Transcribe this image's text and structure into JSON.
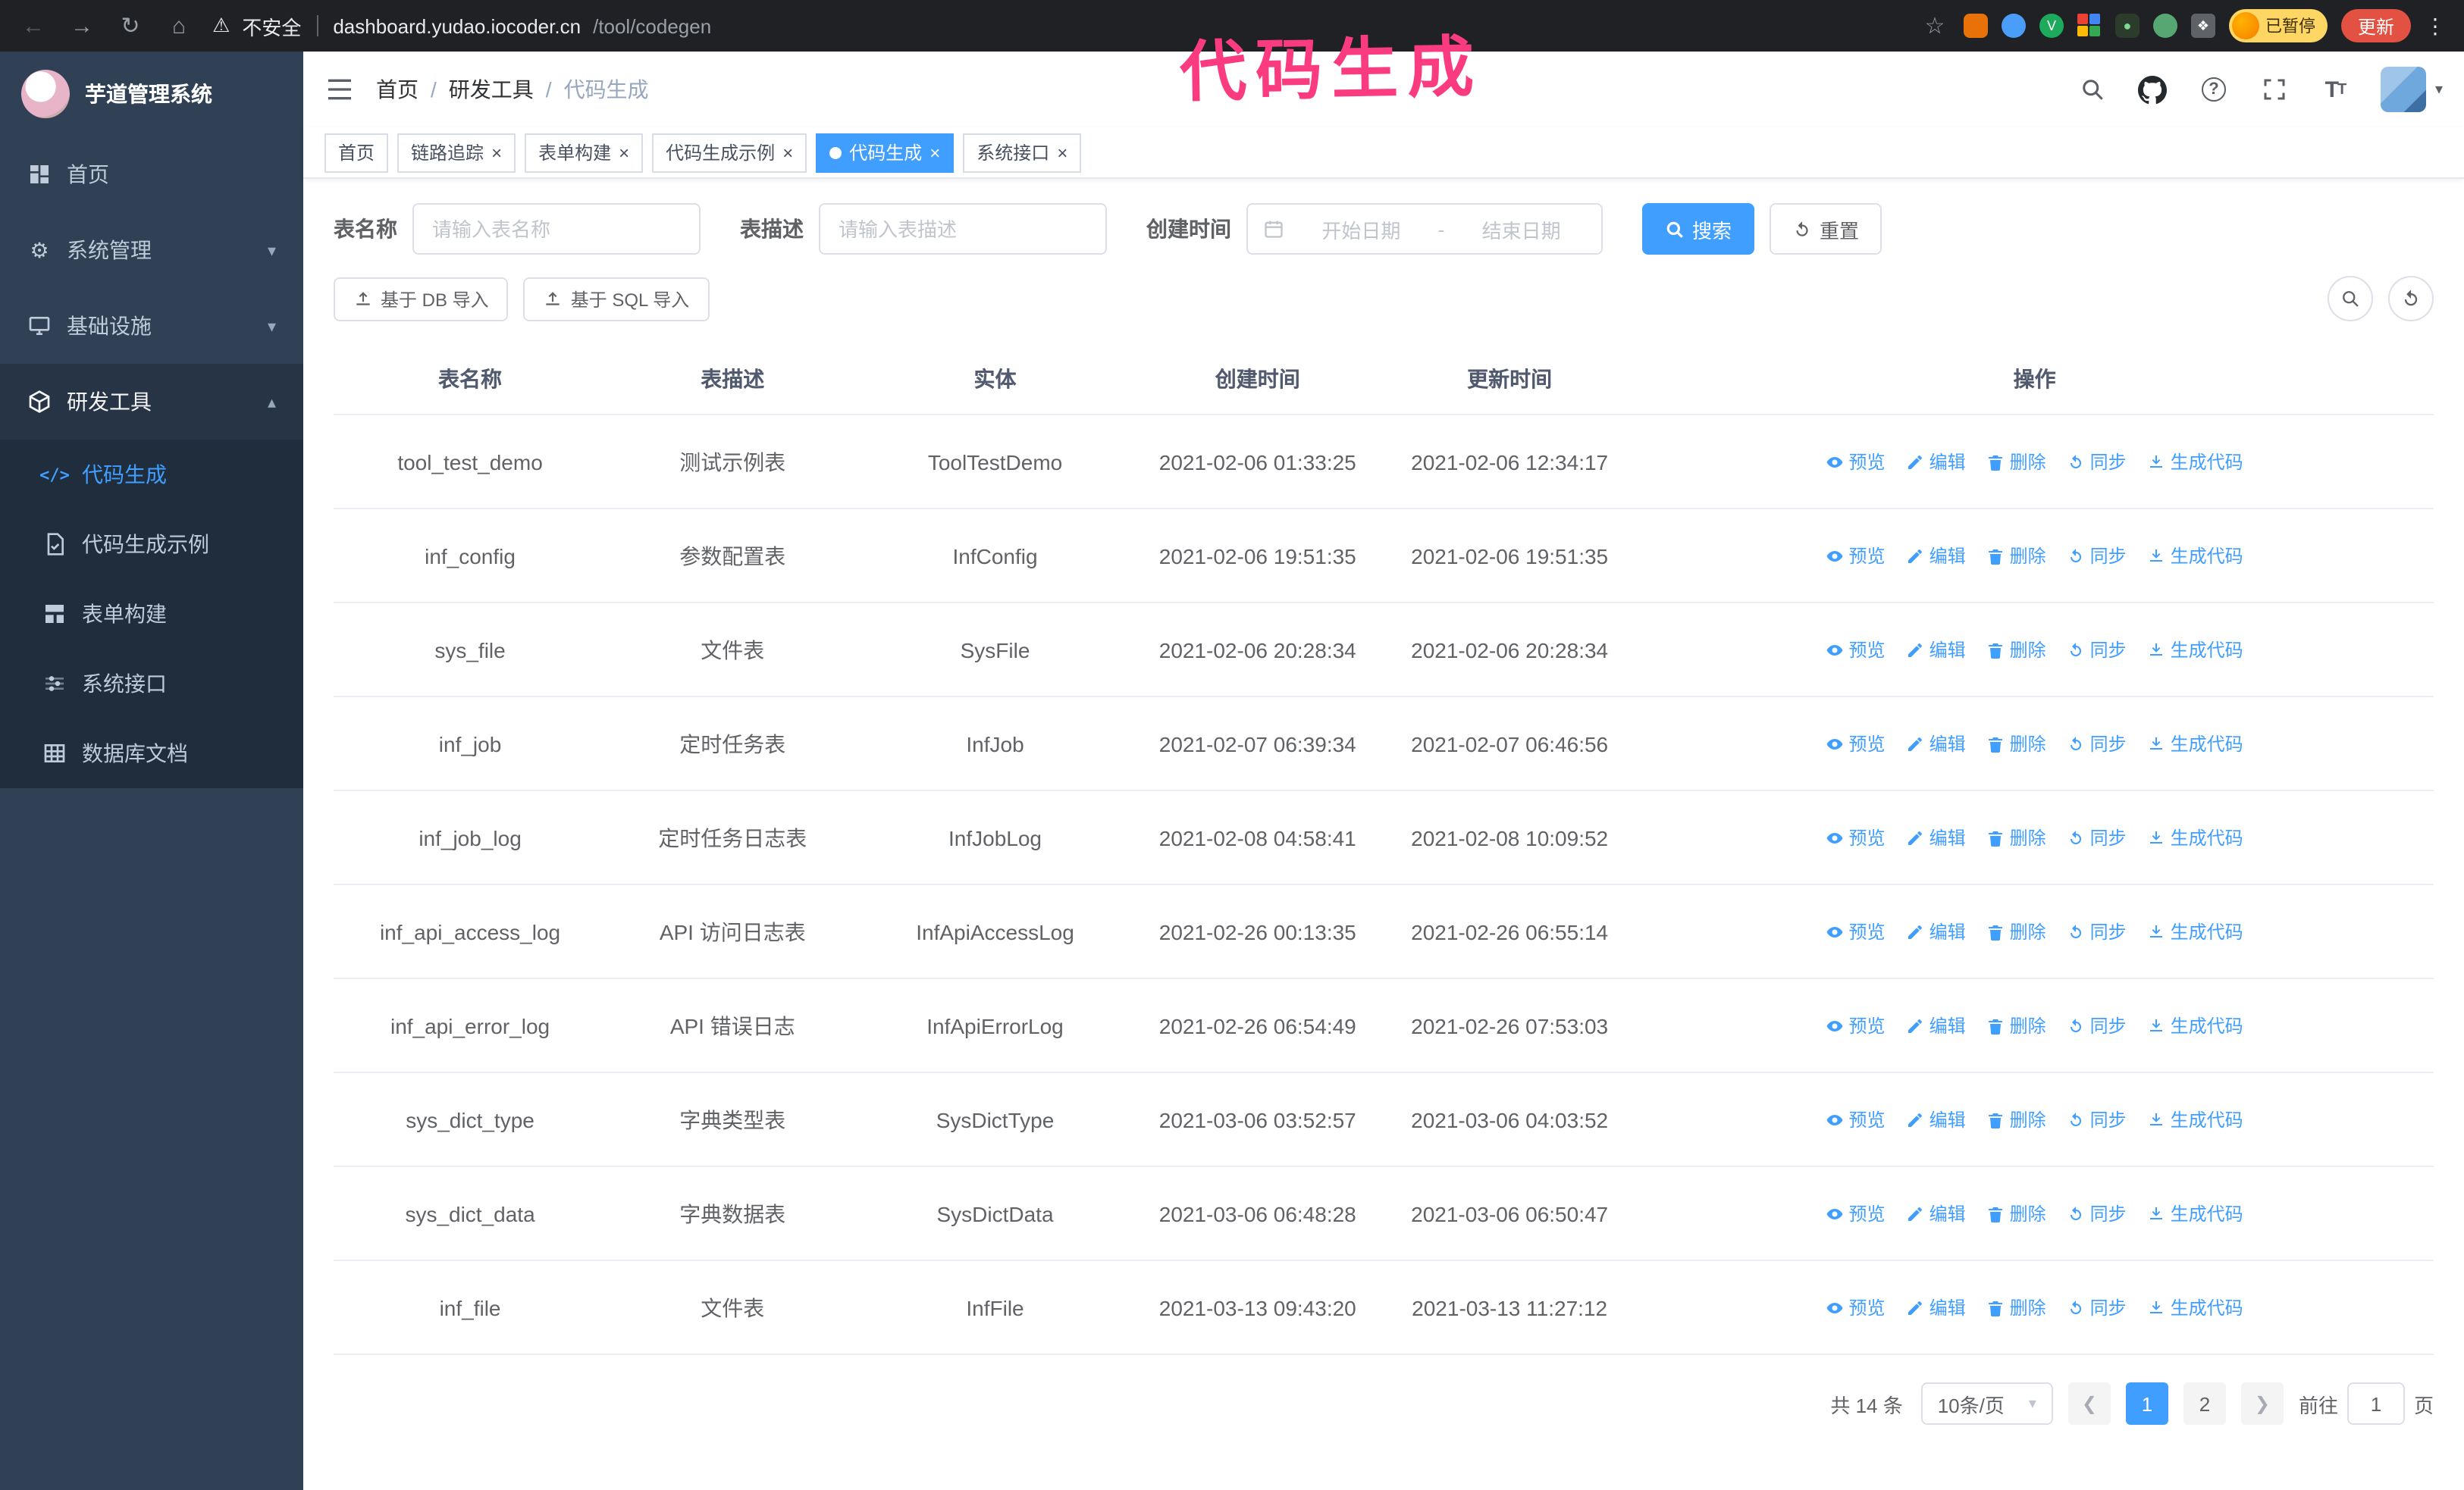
{
  "browser": {
    "security_label": "不安全",
    "url_host": "dashboard.yudao.iocoder.cn",
    "url_path": "/tool/codegen",
    "paused_badge": "已暂停",
    "update_button": "更新"
  },
  "annotation": {
    "text": "代码生成"
  },
  "sidebar": {
    "logo_title": "芋道管理系统",
    "items": [
      {
        "label": "首页"
      },
      {
        "label": "系统管理"
      },
      {
        "label": "基础设施"
      },
      {
        "label": "研发工具"
      }
    ],
    "sub_items": [
      {
        "label": "代码生成"
      },
      {
        "label": "代码生成示例"
      },
      {
        "label": "表单构建"
      },
      {
        "label": "系统接口"
      },
      {
        "label": "数据库文档"
      }
    ]
  },
  "breadcrumb": {
    "separator": "/",
    "items": [
      {
        "label": "首页"
      },
      {
        "label": "研发工具"
      },
      {
        "label": "代码生成"
      }
    ]
  },
  "tags": [
    {
      "label": "首页"
    },
    {
      "label": "链路追踪"
    },
    {
      "label": "表单构建"
    },
    {
      "label": "代码生成示例"
    },
    {
      "label": "代码生成"
    },
    {
      "label": "系统接口"
    }
  ],
  "filters": {
    "name_label": "表名称",
    "name_placeholder": "请输入表名称",
    "desc_label": "表描述",
    "desc_placeholder": "请输入表描述",
    "time_label": "创建时间",
    "start_placeholder": "开始日期",
    "range_separator": "-",
    "end_placeholder": "结束日期",
    "search_button": "搜索",
    "reset_button": "重置"
  },
  "toolbar": {
    "import_db_button": "基于 DB 导入",
    "import_sql_button": "基于 SQL 导入"
  },
  "table": {
    "columns": [
      "表名称",
      "表描述",
      "实体",
      "创建时间",
      "更新时间",
      "操作"
    ],
    "actions": [
      "预览",
      "编辑",
      "删除",
      "同步",
      "生成代码"
    ],
    "rows": [
      {
        "name": "tool_test_demo",
        "desc": "测试示例表",
        "entity": "ToolTestDemo",
        "created": "2021-02-06 01:33:25",
        "updated": "2021-02-06 12:34:17"
      },
      {
        "name": "inf_config",
        "desc": "参数配置表",
        "entity": "InfConfig",
        "created": "2021-02-06 19:51:35",
        "updated": "2021-02-06 19:51:35"
      },
      {
        "name": "sys_file",
        "desc": "文件表",
        "entity": "SysFile",
        "created": "2021-02-06 20:28:34",
        "updated": "2021-02-06 20:28:34"
      },
      {
        "name": "inf_job",
        "desc": "定时任务表",
        "entity": "InfJob",
        "created": "2021-02-07 06:39:34",
        "updated": "2021-02-07 06:46:56"
      },
      {
        "name": "inf_job_log",
        "desc": "定时任务日志表",
        "entity": "InfJobLog",
        "created": "2021-02-08 04:58:41",
        "updated": "2021-02-08 10:09:52"
      },
      {
        "name": "inf_api_access_log",
        "desc": "API 访问日志表",
        "entity": "InfApiAccessLog",
        "created": "2021-02-26 00:13:35",
        "updated": "2021-02-26 06:55:14"
      },
      {
        "name": "inf_api_error_log",
        "desc": "API 错误日志",
        "entity": "InfApiErrorLog",
        "created": "2021-02-26 06:54:49",
        "updated": "2021-02-26 07:53:03"
      },
      {
        "name": "sys_dict_type",
        "desc": "字典类型表",
        "entity": "SysDictType",
        "created": "2021-03-06 03:52:57",
        "updated": "2021-03-06 04:03:52"
      },
      {
        "name": "sys_dict_data",
        "desc": "字典数据表",
        "entity": "SysDictData",
        "created": "2021-03-06 06:48:28",
        "updated": "2021-03-06 06:50:47"
      },
      {
        "name": "inf_file",
        "desc": "文件表",
        "entity": "InfFile",
        "created": "2021-03-13 09:43:20",
        "updated": "2021-03-13 11:27:12"
      }
    ]
  },
  "pagination": {
    "total_text": "共 14 条",
    "page_size": "10条/页",
    "pages": [
      "1",
      "2"
    ],
    "goto_label": "前往",
    "goto_value": "1",
    "goto_suffix": "页"
  },
  "colors": {
    "accent": "#409eff",
    "sidebar_bg": "#304156",
    "submenu_bg": "#1f2d3d",
    "annotation": "#fb3b7f"
  }
}
